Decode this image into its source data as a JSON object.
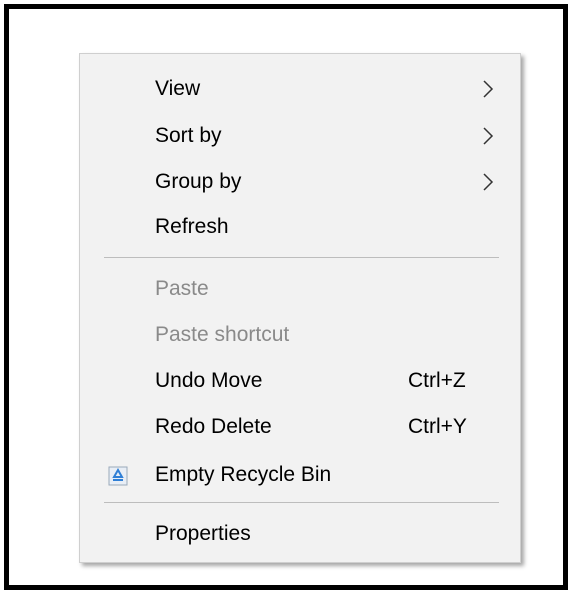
{
  "menu": {
    "items": [
      {
        "label": "View",
        "submenu": true
      },
      {
        "label": "Sort by",
        "submenu": true
      },
      {
        "label": "Group by",
        "submenu": true
      },
      {
        "label": "Refresh"
      },
      {
        "label": "Paste",
        "disabled": true
      },
      {
        "label": "Paste shortcut",
        "disabled": true
      },
      {
        "label": "Undo Move",
        "shortcut": "Ctrl+Z"
      },
      {
        "label": "Redo Delete",
        "shortcut": "Ctrl+Y"
      },
      {
        "label": "Empty Recycle Bin",
        "icon": "recycle-bin-icon"
      },
      {
        "label": "Properties"
      }
    ]
  },
  "colors": {
    "menu_background": "#f2f2f2",
    "disabled_text": "#8a8a8a",
    "separator": "#bdbdbd",
    "recycle_icon_accent": "#2f7fd6"
  }
}
